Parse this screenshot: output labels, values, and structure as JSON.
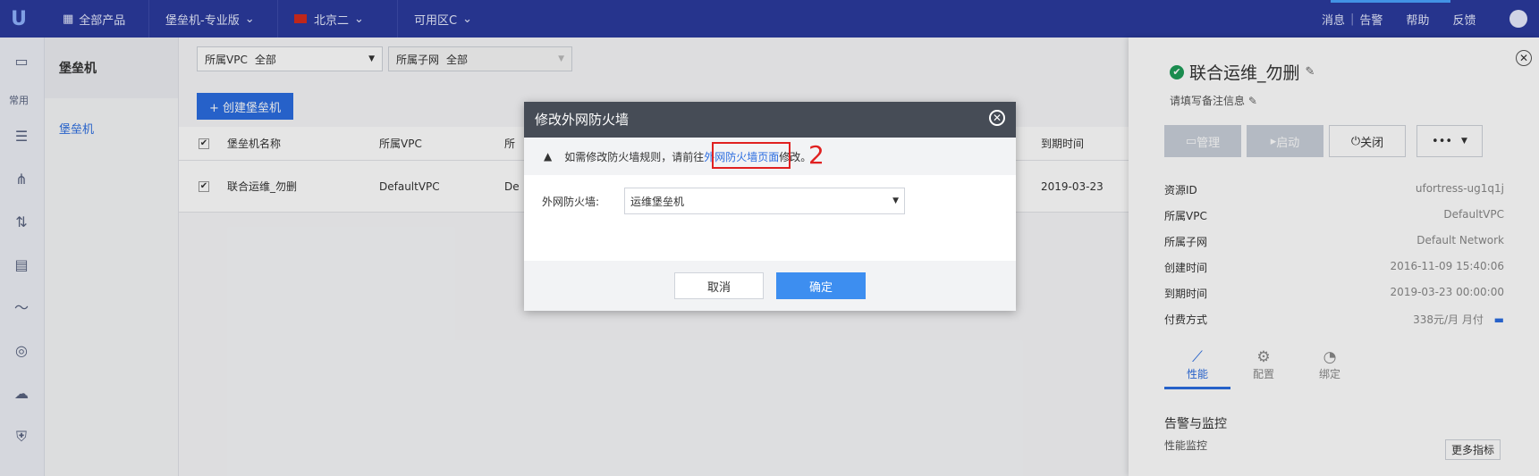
{
  "topbar": {
    "logo": "U",
    "all_products": "全部产品",
    "product": "堡垒机-专业版",
    "region": "北京二",
    "zone": "可用区C",
    "messages": "消息",
    "alerts": "告警",
    "help": "帮助",
    "feedback": "反馈"
  },
  "sidebar": {
    "common_label": "常用"
  },
  "subnav": {
    "title": "堡垒机",
    "item": "堡垒机"
  },
  "main": {
    "filters": [
      {
        "label": "所属VPC",
        "value": "全部"
      },
      {
        "label": "所属子网",
        "value": "全部"
      }
    ],
    "create_button": "+ 创建堡垒机",
    "columns": [
      "堡垒机名称",
      "所属VPC",
      "所",
      "到期时间"
    ],
    "row": {
      "name": "联合运维_勿删",
      "vpc": "DefaultVPC",
      "subnet": "De",
      "expire": "2019-03-23"
    }
  },
  "detail": {
    "title": "联合运维_勿删",
    "note": "请填写备注信息",
    "buttons": {
      "manage": "管理",
      "start": "启动",
      "shutdown": "关闭",
      "more": "•••"
    },
    "fields": [
      {
        "key": "资源ID",
        "value": "ufortress-ug1q1j"
      },
      {
        "key": "所属VPC",
        "value": "DefaultVPC"
      },
      {
        "key": "所属子网",
        "value": "Default Network"
      },
      {
        "key": "创建时间",
        "value": "2016-11-09 15:40:06"
      },
      {
        "key": "到期时间",
        "value": "2019-03-23 00:00:00"
      },
      {
        "key": "付费方式",
        "value": "338元/月 月付"
      }
    ],
    "tabs": [
      "性能",
      "配置",
      "绑定"
    ],
    "section_title": "告警与监控",
    "perf_label": "性能监控",
    "more_metrics": "更多指标"
  },
  "dialog": {
    "title": "修改外网防火墙",
    "tip_before": "如需修改防火墙规则，请前往",
    "tip_link": "外网防火墙页面",
    "tip_after": "修改。",
    "annotation": "2",
    "field_label": "外网防火墙:",
    "field_value": "运维堡垒机",
    "cancel": "取消",
    "confirm": "确定"
  }
}
